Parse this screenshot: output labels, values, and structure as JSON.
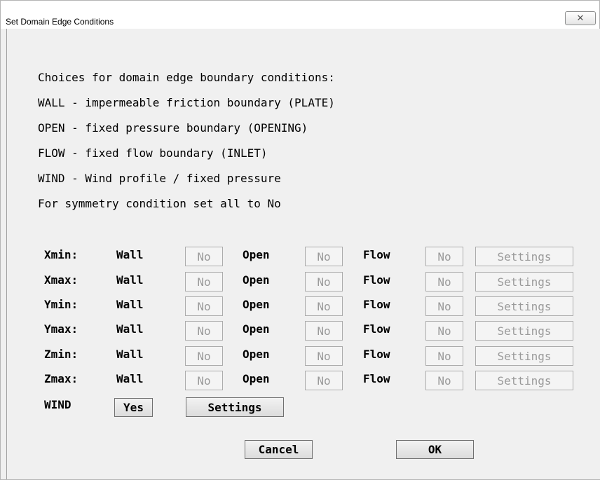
{
  "window": {
    "title": "Set Domain Edge Conditions",
    "close_glyph": "✕"
  },
  "info_lines": [
    "Choices for domain edge boundary conditions:",
    "WALL - impermeable friction boundary (PLATE)",
    "OPEN - fixed pressure boundary (OPENING)",
    "FLOW - fixed flow boundary (INLET)",
    "WIND - Wind profile / fixed pressure",
    "For symmetry condition set all to No"
  ],
  "column_labels": {
    "wall": "Wall",
    "open": "Open",
    "flow": "Flow",
    "settings": "Settings"
  },
  "rows": [
    {
      "edge": "Xmin:",
      "wall": "No",
      "open": "No",
      "flow": "No"
    },
    {
      "edge": "Xmax:",
      "wall": "No",
      "open": "No",
      "flow": "No"
    },
    {
      "edge": "Ymin:",
      "wall": "No",
      "open": "No",
      "flow": "No"
    },
    {
      "edge": "Ymax:",
      "wall": "No",
      "open": "No",
      "flow": "No"
    },
    {
      "edge": "Zmin:",
      "wall": "No",
      "open": "No",
      "flow": "No"
    },
    {
      "edge": "Zmax:",
      "wall": "No",
      "open": "No",
      "flow": "No"
    }
  ],
  "wind": {
    "label": "WIND",
    "value": "Yes",
    "settings": "Settings"
  },
  "footer": {
    "cancel": "Cancel",
    "ok": "OK"
  },
  "colors": {
    "disabled_text": "#9a9a9a",
    "background": "#f0f0f0"
  }
}
